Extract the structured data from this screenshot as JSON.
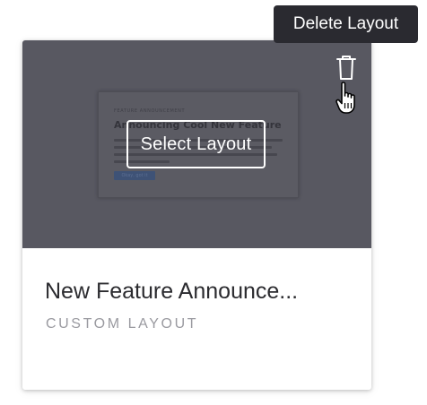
{
  "tooltip": {
    "text": "Delete Layout"
  },
  "card": {
    "title": "New Feature Announce...",
    "subtitle": "CUSTOM LAYOUT",
    "select_label": "Select Layout",
    "delete_icon": "trash-icon",
    "cursor_icon": "hand-pointer-icon"
  },
  "thumbnail": {
    "eyebrow": "FEATURE ANNOUNCEMENT",
    "heading": "Announcing Cool New Feature",
    "button_label": "Okay, got it"
  },
  "colors": {
    "overlay": "#585861",
    "tooltip_bg": "#2a2a30",
    "title": "#2b2b2f",
    "subtitle": "#9a9aa0"
  }
}
